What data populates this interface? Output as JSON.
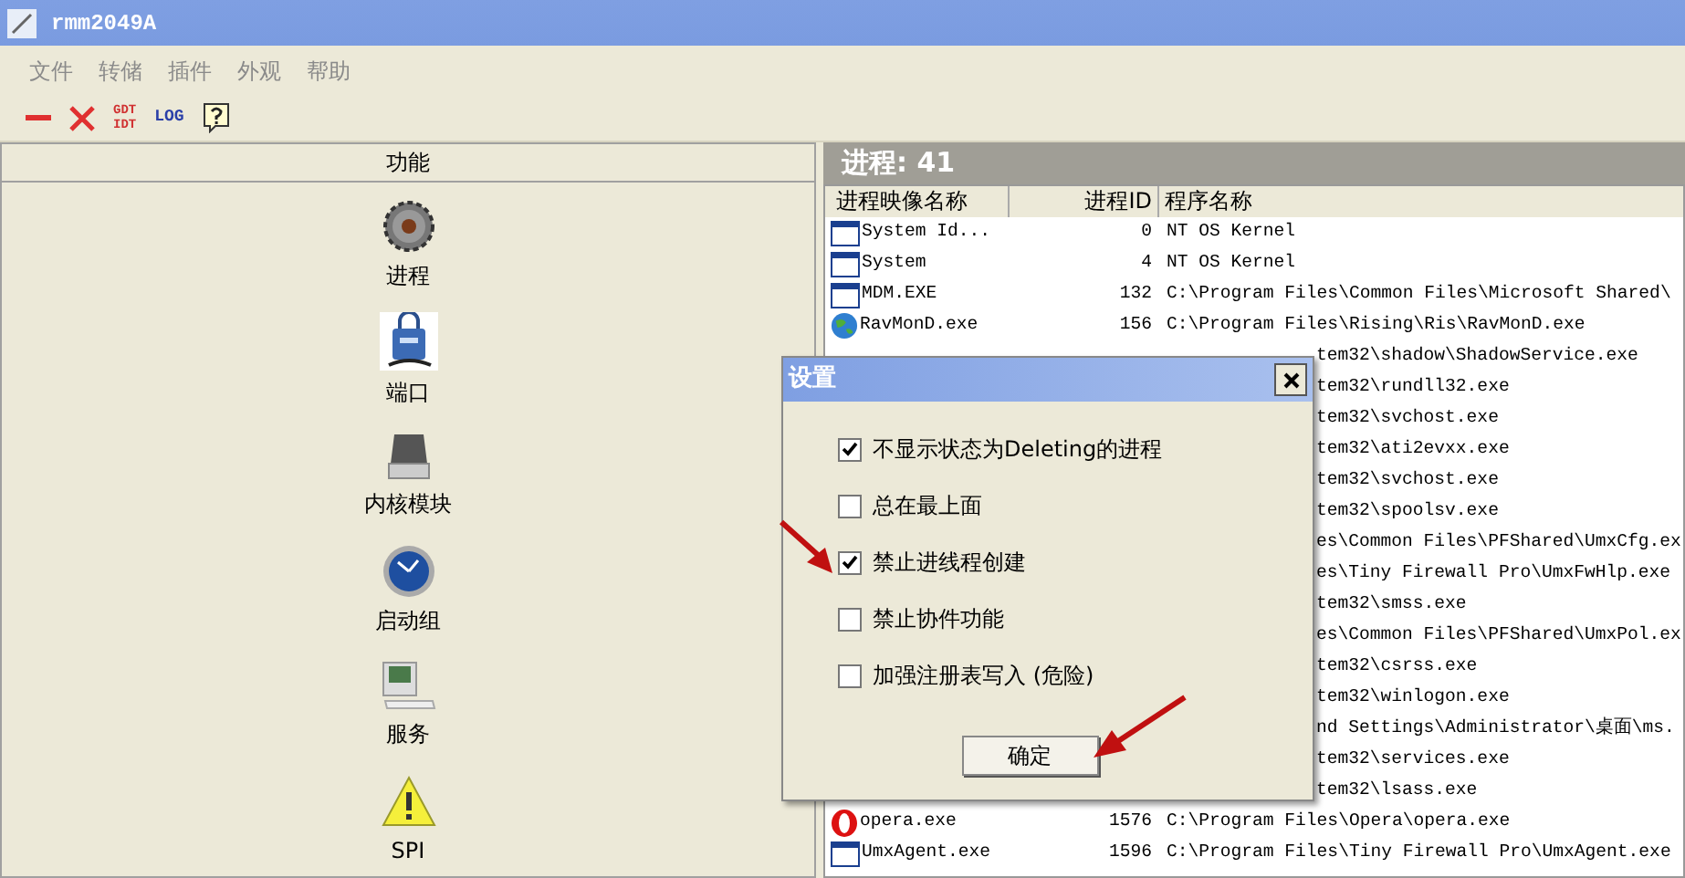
{
  "window": {
    "title": "rmm2049A"
  },
  "menu": [
    "文件",
    "转储",
    "插件",
    "外观",
    "帮助"
  ],
  "toolbar": [
    {
      "kind": "minus"
    },
    {
      "kind": "close"
    },
    {
      "kind": "stacked",
      "lines": [
        "GDT",
        "IDT"
      ]
    },
    {
      "kind": "text",
      "label": "LOG"
    },
    {
      "kind": "help"
    }
  ],
  "sidebar": {
    "header": "功能",
    "items": [
      {
        "label": "进程"
      },
      {
        "label": "端口"
      },
      {
        "label": "内核模块"
      },
      {
        "label": "启动组"
      },
      {
        "label": "服务"
      },
      {
        "label": "SPI"
      }
    ]
  },
  "process_panel": {
    "title": "进程: 41",
    "columns": [
      "进程映像名称",
      "进程ID",
      "程序名称"
    ],
    "rows": [
      {
        "kind": "window",
        "name": "System Id...",
        "pid": "0",
        "path": "NT OS Kernel"
      },
      {
        "kind": "window",
        "name": "System",
        "pid": "4",
        "path": "NT OS Kernel"
      },
      {
        "kind": "window",
        "name": "MDM.EXE",
        "pid": "132",
        "path": "C:\\Program Files\\Common Files\\Microsoft Shared\\"
      },
      {
        "kind": "globe",
        "name": "RavMonD.exe",
        "pid": "156",
        "path": "C:\\Program Files\\Rising\\Ris\\RavMonD.exe"
      },
      {
        "kind": "covered",
        "path": "tem32\\shadow\\ShadowService.exe"
      },
      {
        "kind": "covered",
        "path": "tem32\\rundll32.exe"
      },
      {
        "kind": "covered",
        "path": "tem32\\svchost.exe"
      },
      {
        "kind": "covered",
        "path": "tem32\\ati2evxx.exe"
      },
      {
        "kind": "covered",
        "path": "tem32\\svchost.exe"
      },
      {
        "kind": "covered",
        "path": "tem32\\spoolsv.exe"
      },
      {
        "kind": "covered",
        "path": "es\\Common Files\\PFShared\\UmxCfg.ex"
      },
      {
        "kind": "covered",
        "path": "es\\Tiny Firewall Pro\\UmxFwHlp.exe"
      },
      {
        "kind": "covered",
        "path": "tem32\\smss.exe"
      },
      {
        "kind": "covered",
        "path": "es\\Common Files\\PFShared\\UmxPol.ex"
      },
      {
        "kind": "covered",
        "path": "tem32\\csrss.exe"
      },
      {
        "kind": "covered",
        "path": "tem32\\winlogon.exe"
      },
      {
        "kind": "covered",
        "path": "nd Settings\\Administrator\\桌面\\ms."
      },
      {
        "kind": "covered",
        "path": "tem32\\services.exe"
      },
      {
        "kind": "covered",
        "path": "tem32\\lsass.exe"
      },
      {
        "kind": "opera",
        "name": "opera.exe",
        "pid": "1576",
        "path": "C:\\Program Files\\Opera\\opera.exe"
      },
      {
        "kind": "window",
        "name": "UmxAgent.exe",
        "pid": "1596",
        "path": "C:\\Program Files\\Tiny Firewall Pro\\UmxAgent.exe"
      }
    ]
  },
  "dialog": {
    "title": "设置",
    "options": [
      {
        "label": "不显示状态为Deleting的进程",
        "checked": true
      },
      {
        "label": "总在最上面",
        "checked": false
      },
      {
        "label": "禁止进线程创建",
        "checked": true
      },
      {
        "label": "禁止协件功能",
        "checked": false
      },
      {
        "label": "加强注册表写入 (危险)",
        "checked": false
      }
    ],
    "ok_button": "确定"
  }
}
